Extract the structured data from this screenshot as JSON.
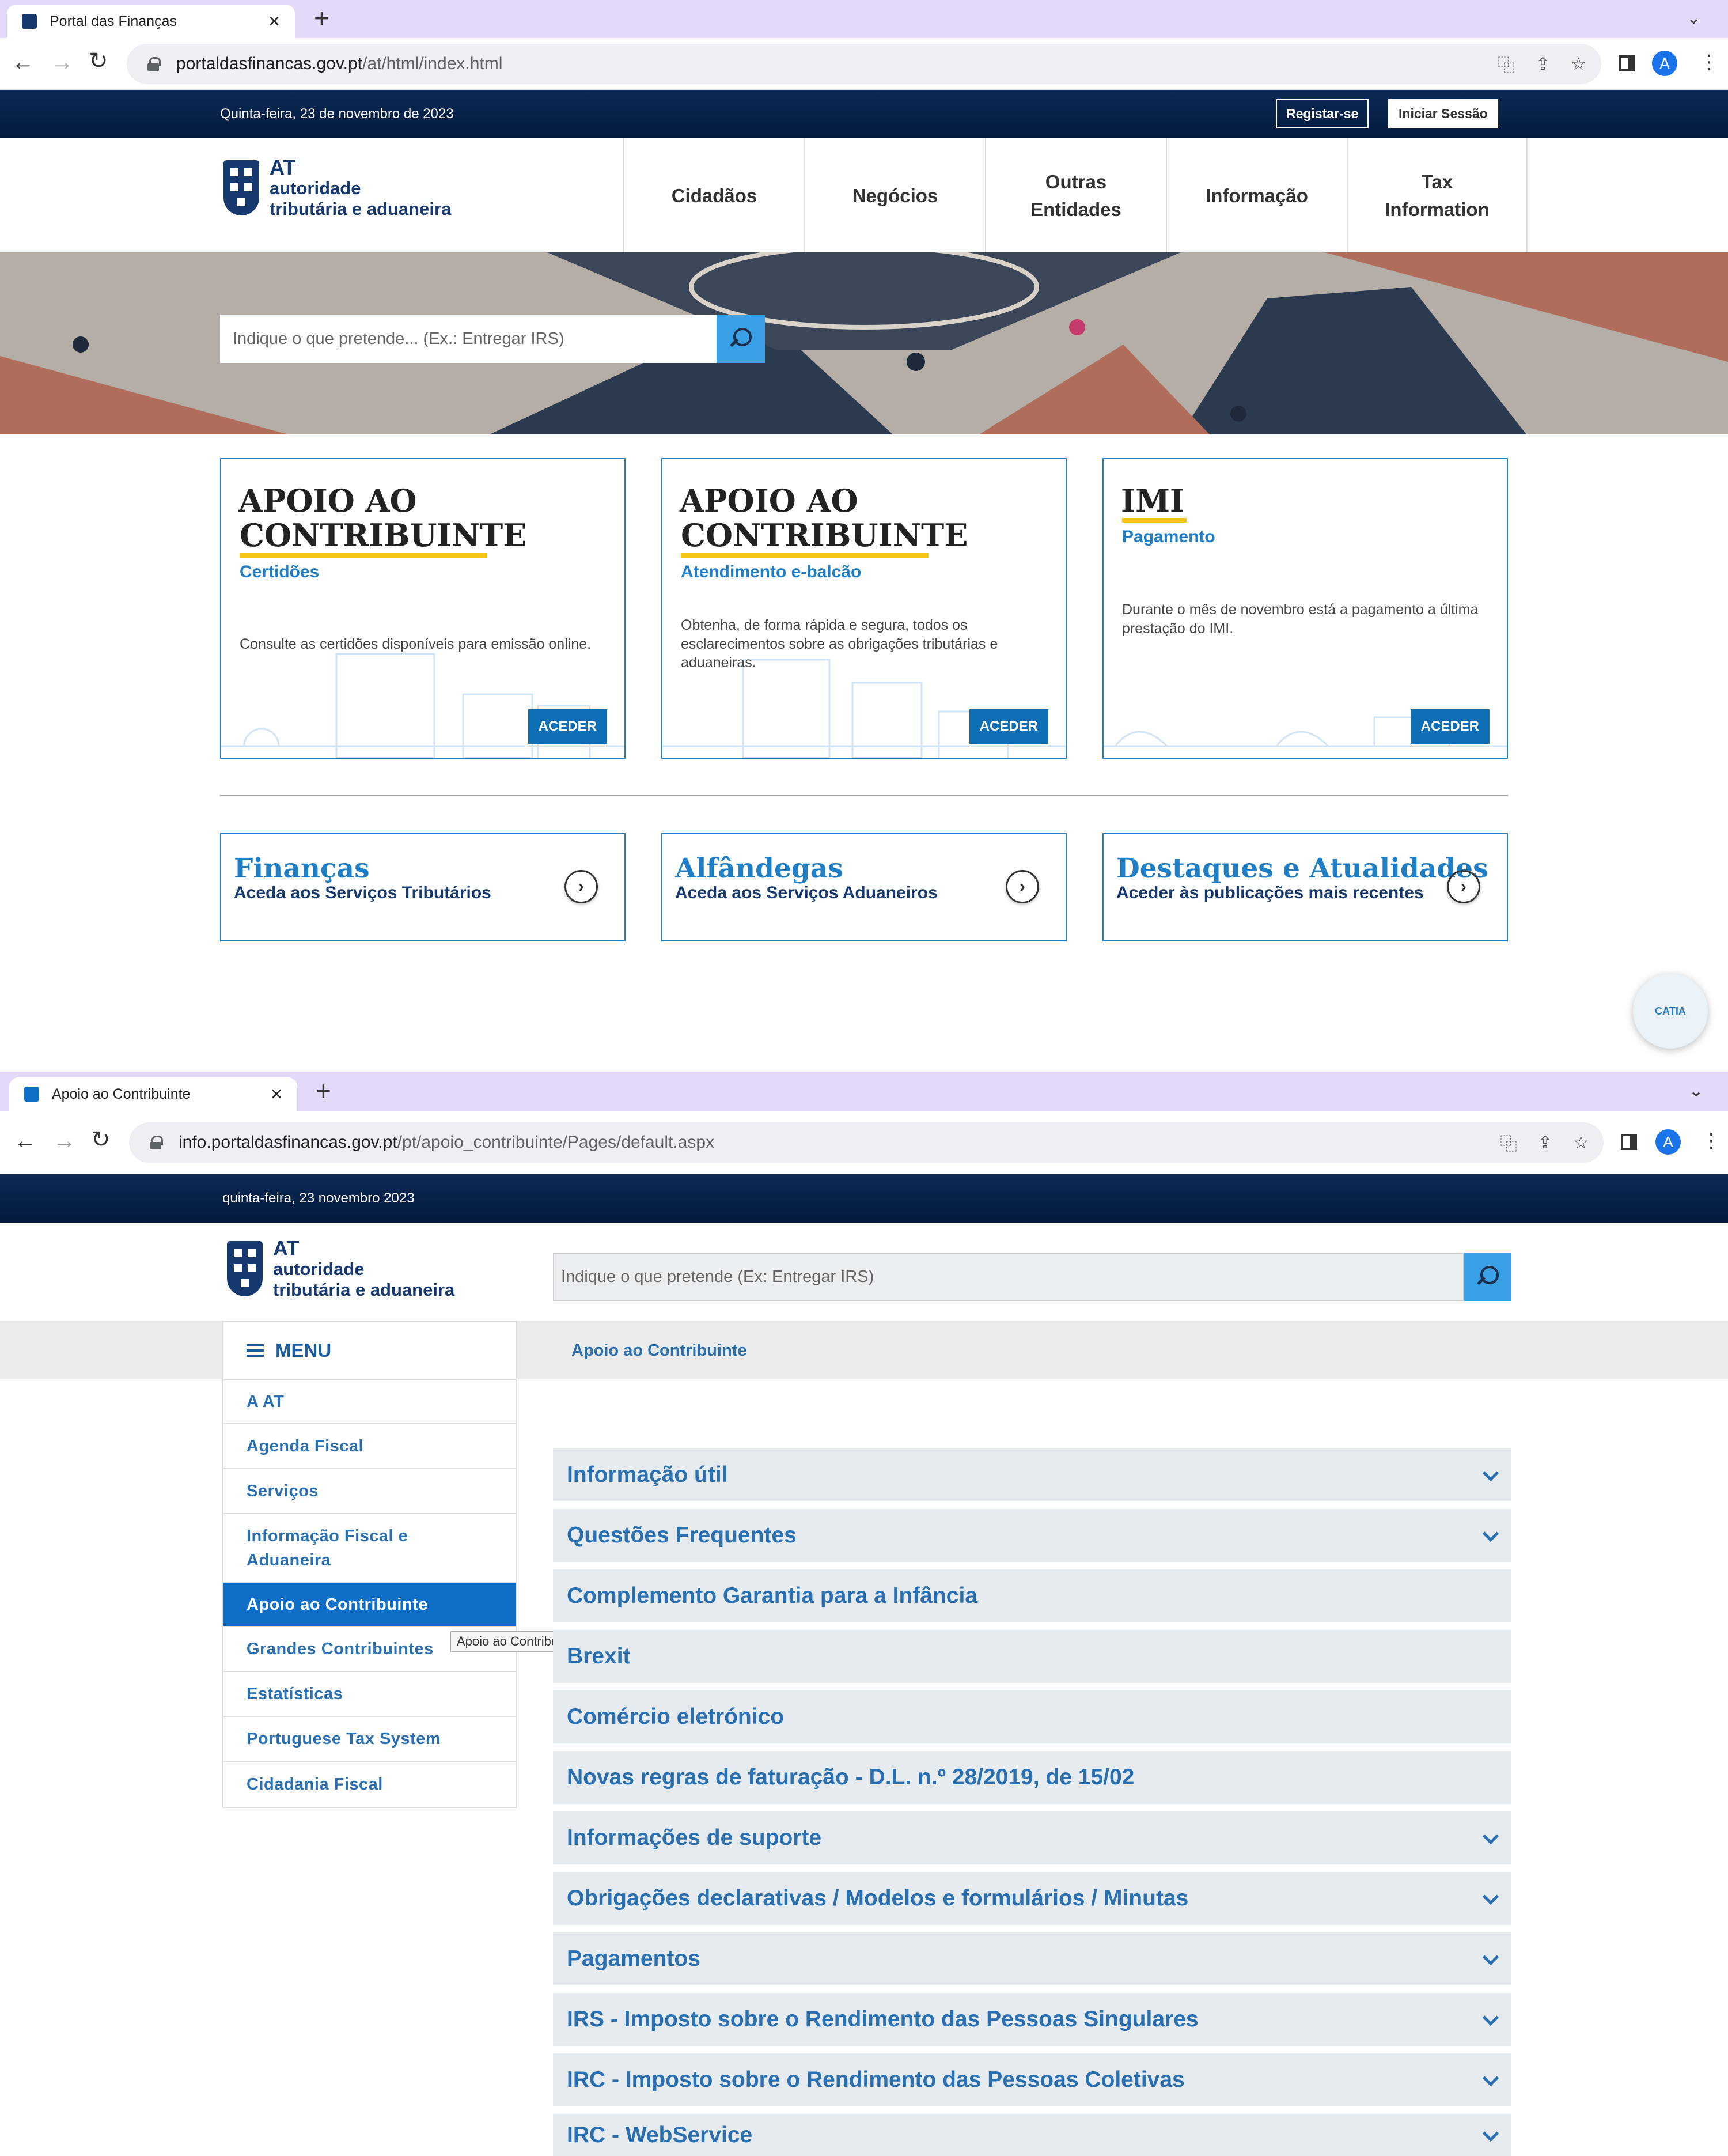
{
  "window1": {
    "tab_title": "Portal das Finanças",
    "url_host": "portaldasfinancas.gov.pt",
    "url_path": "/at/html/index.html",
    "date": "Quinta-feira, 23 de novembro de 2023",
    "register": "Registar-se",
    "login": "Iniciar Sessão",
    "logo": {
      "at": "AT",
      "line1": "autoridade",
      "line2": "tributária e aduaneira"
    },
    "nav": [
      "Cidadãos",
      "Negócios",
      "Outras\nEntidades",
      "Informação",
      "Tax\nInformation"
    ],
    "search_placeholder": "Indique o que pretende... (Ex.: Entregar IRS)",
    "cards": [
      {
        "title1": "APOIO AO",
        "title2": "CONTRIBUINTE",
        "subtitle": "Certidões",
        "desc": "Consulte as certidões disponíveis para emissão online.",
        "button": "ACEDER"
      },
      {
        "title1": "APOIO AO",
        "title2": "CONTRIBUINTE",
        "subtitle": "Atendimento e-balcão",
        "desc": "Obtenha, de forma rápida e segura, todos os esclarecimentos sobre as obrigações tributárias e aduaneiras.",
        "button": "ACEDER"
      },
      {
        "title1": "IMI",
        "title2": "",
        "subtitle": "Pagamento",
        "desc": "Durante o mês de novembro está a pagamento a última prestação do IMI.",
        "button": "ACEDER"
      }
    ],
    "links": [
      {
        "title": "Finanças",
        "sub": "Aceda aos Serviços Tributários"
      },
      {
        "title": "Alfândegas",
        "sub": "Aceda aos Serviços Aduaneiros"
      },
      {
        "title": "Destaques e Atualidades",
        "sub": "Aceder às publicações mais recentes"
      }
    ],
    "catia": "CATIA"
  },
  "window2": {
    "tab_title": "Apoio ao Contribuinte",
    "url_host": "info.portaldasfinancas.gov.pt",
    "url_path": "/pt/apoio_contribuinte/Pages/default.aspx",
    "date": "quinta-feira, 23 novembro 2023",
    "search_placeholder": "Indique o que pretende (Ex: Entregar IRS)",
    "menu_label": "MENU",
    "breadcrumb": "Apoio ao Contribuinte",
    "menu_items": [
      "A AT",
      "Agenda Fiscal",
      "Serviços",
      "Informação Fiscal e Aduaneira",
      "Apoio ao Contribuinte",
      "Grandes Contribuintes",
      "Estatísticas",
      "Portuguese Tax System",
      "Cidadania Fiscal"
    ],
    "tooltip": "Apoio ao Contribuinte",
    "sections": [
      {
        "label": "Informação útil",
        "expandable": true
      },
      {
        "label": "Questões Frequentes",
        "expandable": true
      },
      {
        "label": "Complemento Garantia para a Infância",
        "expandable": false
      },
      {
        "label": "Brexit",
        "expandable": false
      },
      {
        "label": "Comércio eletrónico",
        "expandable": false
      },
      {
        "label": "Novas regras de faturação - D.L. n.º 28/2019, de 15/02",
        "expandable": false
      },
      {
        "label": "Informações de suporte",
        "expandable": true
      },
      {
        "label": "Obrigações declarativas / Modelos e formulários / Minutas",
        "expandable": true
      },
      {
        "label": "Pagamentos",
        "expandable": true
      },
      {
        "label": "IRS - Imposto sobre o Rendimento das Pessoas Singulares",
        "expandable": true
      },
      {
        "label": "IRC - Imposto sobre o Rendimento das Pessoas Coletivas",
        "expandable": true
      },
      {
        "label": "IRC - WebService",
        "expandable": true
      }
    ]
  },
  "colors": {
    "brand_navy": "#0c2a55",
    "accent_blue": "#1f7ec4",
    "highlight_yellow": "#f5c518",
    "tab_bar": "#e5d9f9"
  }
}
